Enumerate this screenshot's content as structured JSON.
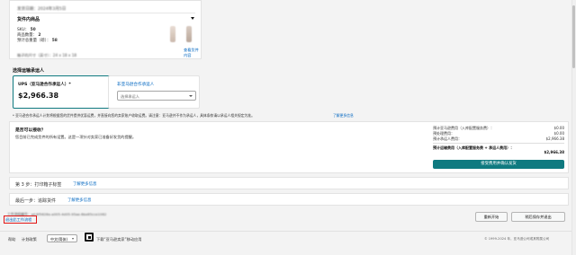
{
  "shipment": {
    "ship_date_label": "发货日期：",
    "ship_date_value": "2024年3月5日",
    "contents_label": "货件内商品",
    "sku_count_label": "SKU：",
    "sku_count_value": "2",
    "units_label": "商品数量：",
    "units_value": "50",
    "boxes_label": "箱数：",
    "boxes_value": "2",
    "weight_label": "预计总重量（磅）：",
    "weight_value": "58",
    "view_contents_link": "查看货件内容",
    "dims_label": "箱子的尺寸（英寸）：",
    "dims_value": "24 x 18 x 18"
  },
  "carrier": {
    "section_title": "选择运输承运人",
    "ups_title": "UPS（亚马逊合作承运人）*",
    "ups_price": "$2,966.38",
    "non_partner_title": "非亚马逊合作承运人",
    "non_partner_placeholder": "选择承运人",
    "disclaimer": "* 亚马逊合作承运人计划将根据您的货件提供优惠运费，并直接向您的卖家账户收取运费。请注意：亚马逊并不作为承运人，具体条款请以承运人相关规定为准。",
    "learn_more": "了解更多信息"
  },
  "summary": {
    "ready_title": "是否可以接收？",
    "ready_desc": "您目前已完成货件的所有设置。这是一项针对卖家已准备好发货的提醒。",
    "estimated_fees_label": "预计亚马逊费用（入库配置服务费）：",
    "estimated_fees_value": "$0.00",
    "prep_fees_label": "预处理费用：",
    "prep_fees_value": "$0.00",
    "carrier_fees_label": "预计承运人费用：",
    "carrier_fees_value": "$2,966.38",
    "total_label": "预计运输费用（入库配置服务费 + 承运人费用）：",
    "total_value": "$2,966.38",
    "accept_button": "接受费用并确认发货"
  },
  "steps": {
    "step3_label": "第 3 步：打印箱子标签",
    "step3_link": "了解更多信息",
    "step4_label": "最后一步：追踪货件",
    "step4_link": "了解更多信息"
  },
  "footer_actions": {
    "workflow_id": "工作流程编号：wf-8f5626e-a005-4d05-95ae-6be65cce1062",
    "exit_link": "退出此工作流程",
    "restart_button": "重新开始",
    "save_exit_button": "稍后保存并退出"
  },
  "footer": {
    "help": "帮助",
    "privacy": "计划政策",
    "language": "中文(简体)",
    "app_label": "下载“亚马逊卖家”移动应用",
    "copyright": "© 1999-2024 年，亚马逊公司或其附属公司"
  }
}
